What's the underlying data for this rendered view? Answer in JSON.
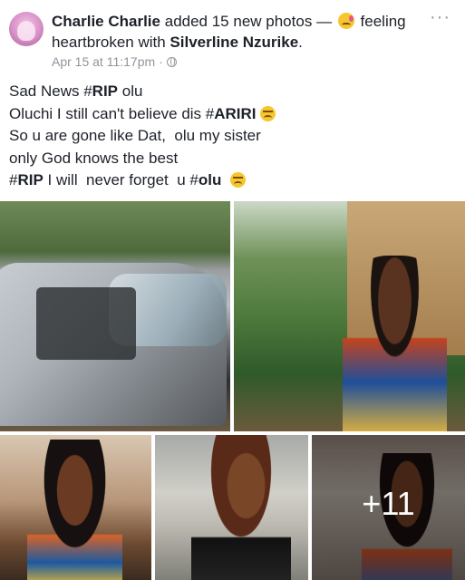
{
  "post": {
    "author": "Charlie Charlie",
    "action": "added 15 new photos",
    "separator": "—",
    "feeling_label": "feeling heartbroken with",
    "tagged_person": "Silverline Nzurike",
    "tagged_suffix": ".",
    "timestamp": "Apr 15 at 11:17pm",
    "timestamp_dot": "·",
    "privacy_icon": "globe-icon",
    "more_label": "···"
  },
  "body": {
    "line1_pre": "Sad News #",
    "line1_bold": "RIP",
    "line1_post": " olu",
    "line2_pre": "Oluchi I still can't believe dis #",
    "line2_bold": "ARIRI",
    "line3": "So u are gone like Dat,  olu my sister",
    "line4": "only God knows the best",
    "line5_pre": "#",
    "line5_bold1": "RIP",
    "line5_mid": " I will  never forget  u #",
    "line5_bold2": "olu"
  },
  "photos": {
    "more_count": "+11"
  },
  "colors": {
    "text": "#1d2129",
    "meta": "#90949c",
    "emoji": "#f7c62f"
  }
}
